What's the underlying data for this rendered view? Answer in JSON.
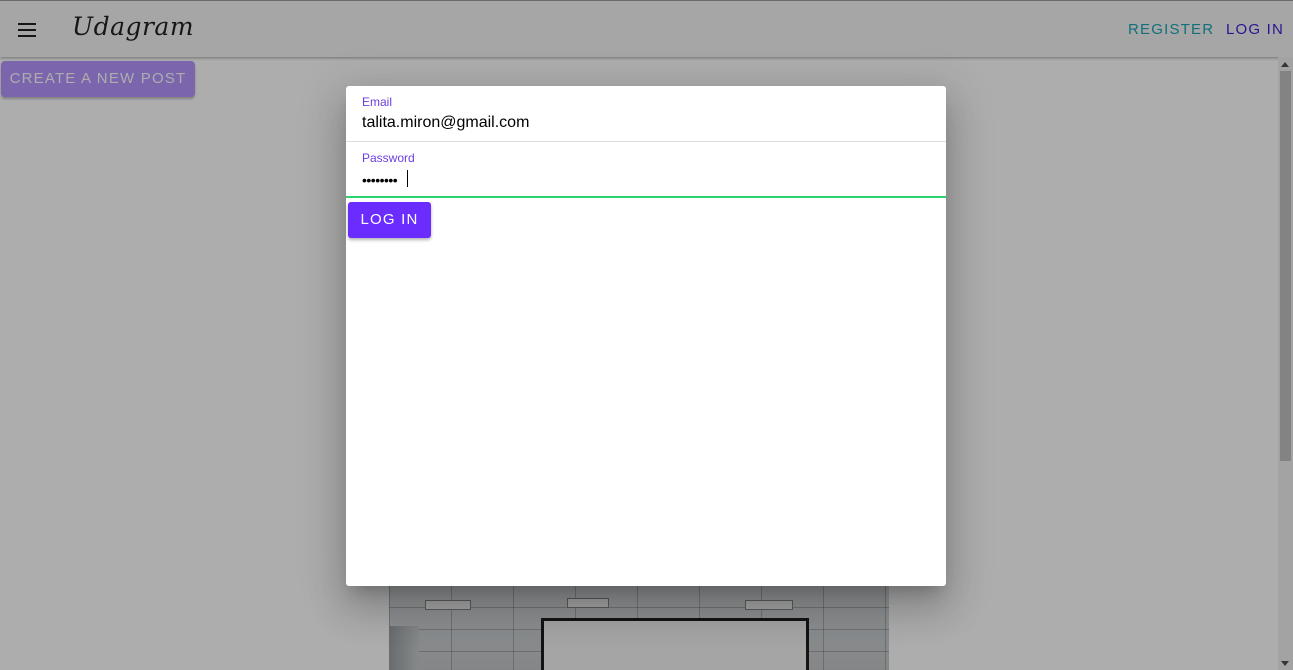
{
  "header": {
    "menu_icon": "hamburger-menu-icon",
    "brand": "Udagram",
    "register_label": "REGISTER",
    "login_label": "LOG IN"
  },
  "main": {
    "create_post_label": "CREATE A NEW POST"
  },
  "modal": {
    "email": {
      "label": "Email",
      "value": "talita.miron@gmail.com"
    },
    "password": {
      "label": "Password",
      "value": "••••••••"
    },
    "submit_label": "LOG IN"
  },
  "colors": {
    "register_link": "#1aa6b7",
    "login_link": "#3f1ed6",
    "primary_button": "#6a2cff",
    "focus_underline": "#2dd36f",
    "field_label": "#6a3ee0"
  }
}
